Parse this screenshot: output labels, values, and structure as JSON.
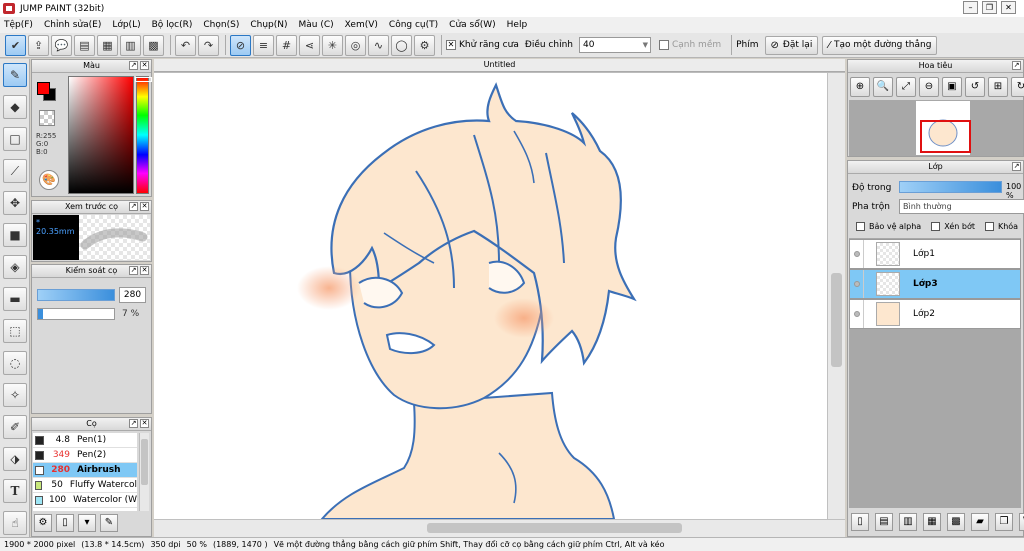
{
  "window": {
    "title": "JUMP PAINT (32bit)",
    "controls": [
      "–",
      "❐",
      "✕"
    ]
  },
  "menu": [
    "Tệp(F)",
    "Chỉnh sửa(E)",
    "Lớp(L)",
    "Bộ lọc(R)",
    "Chọn(S)",
    "Chụp(N)",
    "Màu (C)",
    "Xem(V)",
    "Công cụ(T)",
    "Cửa sổ(W)",
    "Help"
  ],
  "toolbar": {
    "antialias_label": "Khử răng cưa",
    "antialias_checked": true,
    "correction_label": "Điều chỉnh",
    "correction_value": "40",
    "smooth_label": "Cạnh mềm",
    "shortcut_label": "Phím",
    "reset_label": "Đặt lại",
    "line_label": "Tạo một đường thẳng"
  },
  "tools": [
    "pen",
    "eraser",
    "rect",
    "bucket",
    "move",
    "fill",
    "bucket2",
    "gradient",
    "select",
    "lasso",
    "magic-wand",
    "select-pen",
    "select-eraser",
    "text",
    "hand"
  ],
  "color_panel": {
    "title": "Màu",
    "foreground": "#ff0000",
    "background": "#000000",
    "r": "R:255",
    "g": "G:0",
    "b": "B:0"
  },
  "preview_panel": {
    "title": "Xem trước cọ",
    "size_label": "* 20.35mm"
  },
  "control_panel": {
    "title": "Kiểm soát cọ",
    "size": "280",
    "opacity": "7 %",
    "opacity_fraction": 0.07
  },
  "brush_panel": {
    "title": "Cọ",
    "brushes": [
      {
        "size": "4.8",
        "name": "Pen(1)",
        "swatch": "#222222",
        "selected": false
      },
      {
        "size": "349",
        "name": "Pen(2)",
        "swatch": "#222222",
        "selected": false
      },
      {
        "size": "280",
        "name": "Airbrush",
        "swatch": "#ffffff",
        "selected": true
      },
      {
        "size": "50",
        "name": "Fluffy Watercol",
        "swatch": "#c8e87a",
        "selected": false
      },
      {
        "size": "100",
        "name": "Watercolor (W",
        "swatch": "#9ee6f5",
        "selected": false
      }
    ]
  },
  "canvas": {
    "title": "Untitled"
  },
  "navigator": {
    "title": "Hoa tiêu"
  },
  "layer_panel": {
    "title": "Lớp",
    "opacity_label": "Độ trong",
    "opacity_value": "100 %",
    "blend_label": "Pha trộn",
    "blend_value": "Bình thường",
    "protect_alpha": "Bảo vệ alpha",
    "clipping": "Xén bớt",
    "lock": "Khóa",
    "layers": [
      {
        "name": "Lớp1",
        "selected": false,
        "thumb": "blank"
      },
      {
        "name": "Lớp3",
        "selected": true,
        "thumb": "blank"
      },
      {
        "name": "Lớp2",
        "selected": false,
        "thumb": "skin"
      }
    ]
  },
  "status": {
    "size": "1900 * 2000 pixel",
    "physical": "(13.8 * 14.5cm)",
    "dpi": "350 dpi",
    "zoom": "50 %",
    "coords": "(1889, 1470 )",
    "hint": "Vẽ một đường thẳng bằng cách giữ phím Shift, Thay đổi cỡ cọ bằng cách giữ phím Ctrl, Alt và kéo"
  }
}
